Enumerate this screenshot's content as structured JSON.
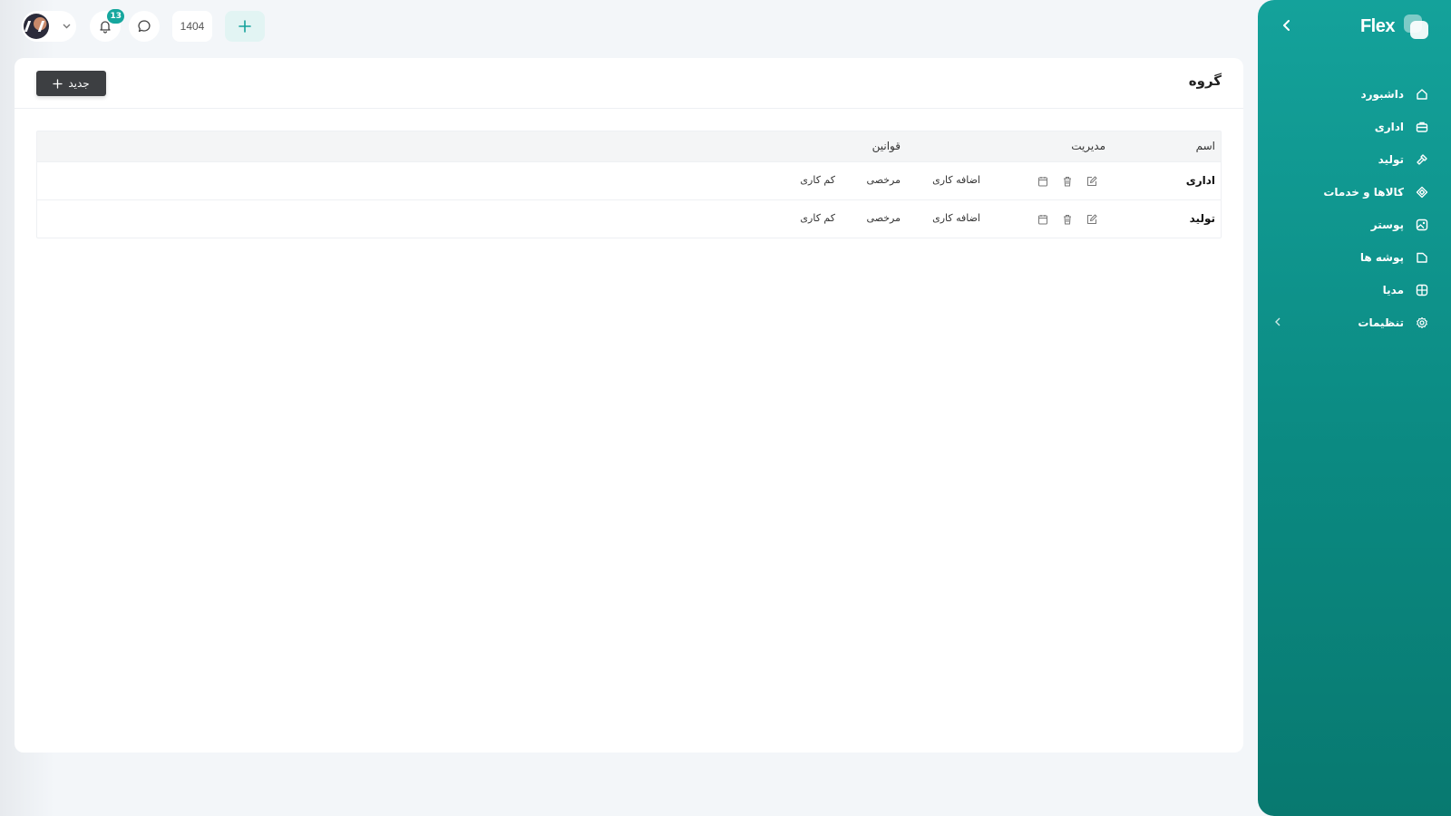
{
  "brand": {
    "name": "Flex"
  },
  "sidebar": {
    "items": [
      {
        "label": "داشبورد",
        "icon": "home-icon"
      },
      {
        "label": "اداری",
        "icon": "briefcase-icon"
      },
      {
        "label": "تولید",
        "icon": "hammer-icon"
      },
      {
        "label": "کالاها و خدمات",
        "icon": "box-icon"
      },
      {
        "label": "پوستر",
        "icon": "image-icon"
      },
      {
        "label": "پوشه ها",
        "icon": "folder-icon"
      },
      {
        "label": "مدیا",
        "icon": "media-grid-icon"
      },
      {
        "label": "تنظیمات",
        "icon": "gear-icon",
        "has_submenu": true
      }
    ]
  },
  "topbar": {
    "notifications_count": "13",
    "year": "1404"
  },
  "page": {
    "title": "گروه",
    "new_button_label": "جدید"
  },
  "table": {
    "headers": {
      "name": "اسم",
      "management": "مدیریت",
      "rules": "قوانین"
    },
    "rows": [
      {
        "name": "اداری",
        "rules": [
          "اضافه کاری",
          "مرخصی",
          "کم کاری"
        ]
      },
      {
        "name": "تولید",
        "rules": [
          "اضافه کاری",
          "مرخصی",
          "کم کاری"
        ]
      }
    ]
  },
  "colors": {
    "accent": "#14a29b",
    "sidebar_dark": "#087970",
    "button_dark": "#3d3f42",
    "background": "#f3f6f9"
  }
}
